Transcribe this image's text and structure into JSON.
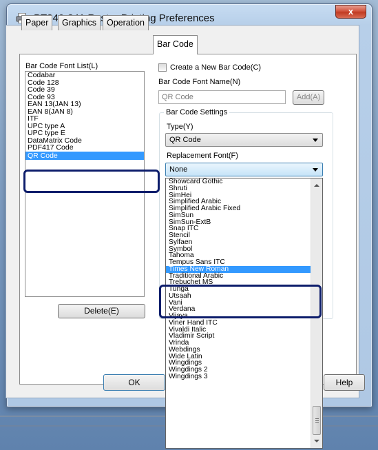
{
  "window": {
    "title": "PT340-341 Raster Printing Preferences",
    "close_label": "x"
  },
  "tabs": [
    {
      "label": "Paper",
      "active": false
    },
    {
      "label": "Graphics",
      "active": false
    },
    {
      "label": "Operation",
      "active": false
    },
    {
      "label": "Bar Code",
      "active": true
    }
  ],
  "font_list": {
    "label": "Bar Code Font List(L)",
    "items": [
      "Codabar",
      "Code 128",
      "Code 39",
      "Code 93",
      "EAN 13(JAN 13)",
      "EAN 8(JAN 8)",
      "ITF",
      "UPC type A",
      "UPC type E",
      "DataMatrix Code",
      "PDF417 Code",
      "QR Code"
    ],
    "selected": "QR Code"
  },
  "delete_label": "Delete(E)",
  "create_new_label": "Create a New Bar Code(C)",
  "font_name": {
    "label": "Bar Code Font Name(N)",
    "value": "QR Code",
    "add_label": "Add(A)"
  },
  "settings": {
    "group_label": "Bar Code Settings",
    "type_label": "Type(Y)",
    "type_value": "QR Code",
    "replacement_label": "Replacement Font(F)",
    "replacement_value": "None"
  },
  "replacement_options": [
    "Showcard Gothic",
    "Shruti",
    "SimHei",
    "Simplified Arabic",
    "Simplified Arabic Fixed",
    "SimSun",
    "SimSun-ExtB",
    "Snap ITC",
    "Stencil",
    "Sylfaen",
    "Symbol",
    "Tahoma",
    "Tempus Sans ITC",
    "Times New Roman",
    "Traditional Arabic",
    "Trebuchet MS",
    "Tunga",
    "Utsaah",
    "Vani",
    "Verdana",
    "Vijaya",
    "Viner Hand ITC",
    "Vivaldi Italic",
    "Vladimir Script",
    "Vrinda",
    "Webdings",
    "Wide Latin",
    "Wingdings",
    "Wingdings 2",
    "Wingdings 3"
  ],
  "replacement_selected": "Times New Roman",
  "footer": {
    "ok_label": "OK",
    "help_label": "Help"
  },
  "colors": {
    "selection": "#3399ff",
    "highlight_box": "#0d1d6b"
  }
}
